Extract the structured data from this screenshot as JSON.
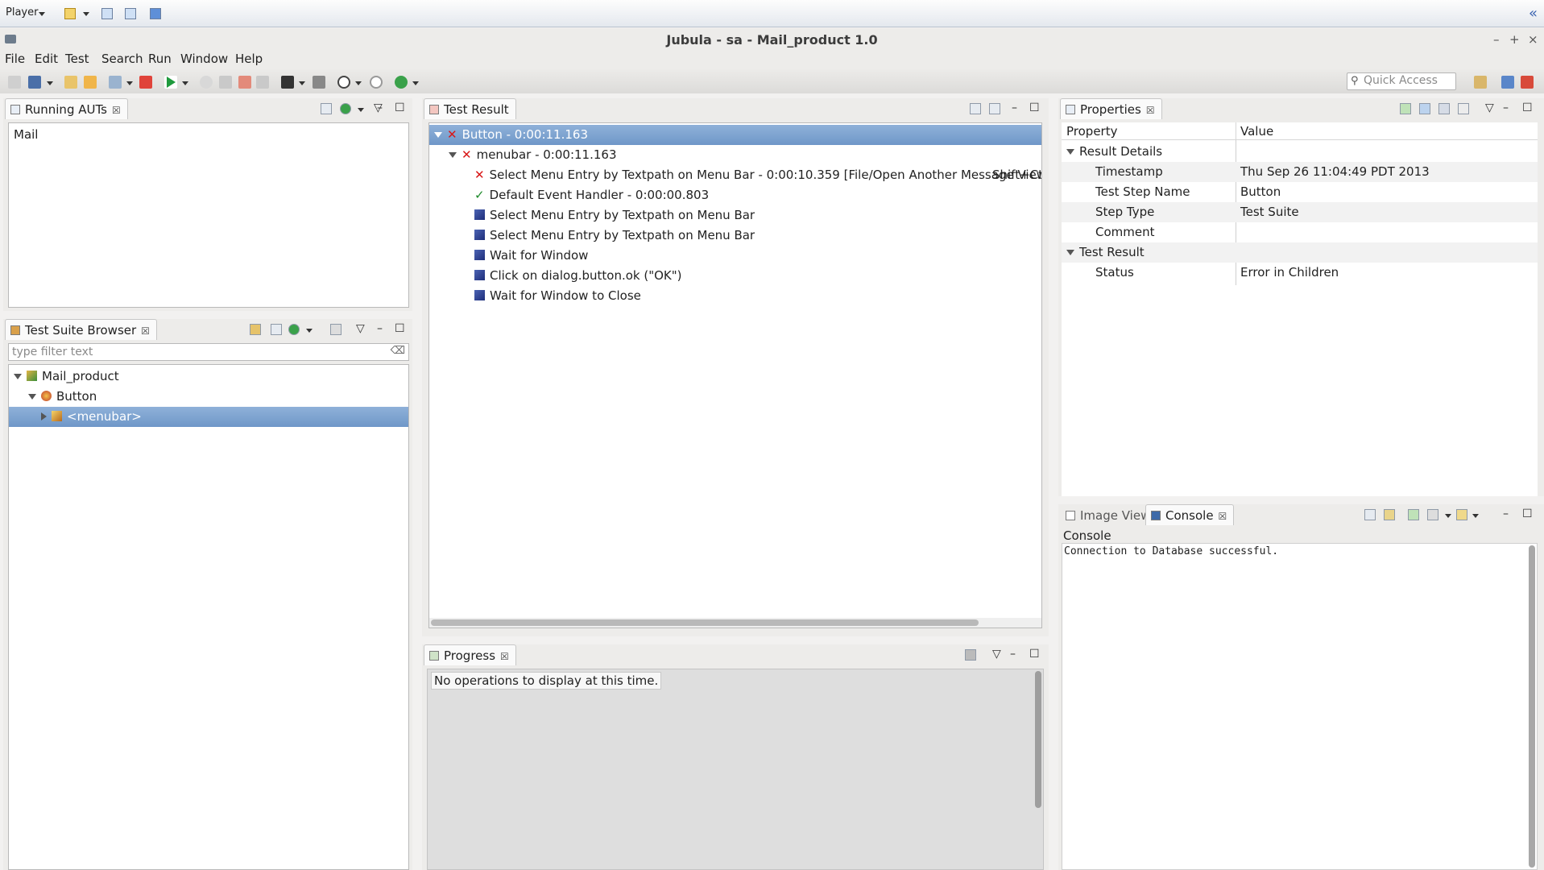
{
  "player_bar": {
    "label": "Player",
    "collapse_glyph": "«"
  },
  "window": {
    "title": "Jubula - sa - Mail_product 1.0",
    "controls": [
      "–",
      "+",
      "×"
    ]
  },
  "menu": {
    "items": [
      "File",
      "Edit",
      "Test",
      "Search",
      "Run",
      "Window",
      "Help"
    ]
  },
  "toolbar": {
    "quick_access_placeholder": "Quick Access"
  },
  "running_auts": {
    "tab_label": "Running AUTs",
    "items": [
      "Mail"
    ]
  },
  "test_suite_browser": {
    "tab_label": "Test Suite Browser",
    "filter_placeholder": "type filter text",
    "tree": {
      "root": "Mail_product",
      "child": "Button",
      "grandchild": "<menubar>"
    }
  },
  "test_result": {
    "tab_label": "Test Result",
    "root": "Button - 0:00:11.163",
    "menubar": "menubar - 0:00:11.163",
    "steps": [
      {
        "status": "fail",
        "text": "Select Menu Entry by Textpath on Menu Bar - 0:00:10.359 [File/Open Another Message View",
        "extra": "Shift+Ctr"
      },
      {
        "status": "pass",
        "text": "Default Event Handler - 0:00:00.803",
        "extra": ""
      },
      {
        "status": "pending",
        "text": "Select Menu Entry by Textpath on Menu Bar",
        "extra": ""
      },
      {
        "status": "pending",
        "text": "Select Menu Entry by Textpath on Menu Bar",
        "extra": ""
      },
      {
        "status": "pending",
        "text": "Wait for Window",
        "extra": ""
      },
      {
        "status": "pending",
        "text": "Click on dialog.button.ok (\"OK\")",
        "extra": ""
      },
      {
        "status": "pending",
        "text": "Wait for Window to Close",
        "extra": ""
      }
    ]
  },
  "progress": {
    "tab_label": "Progress",
    "message": "No operations to display at this time."
  },
  "properties": {
    "tab_label": "Properties",
    "col_property": "Property",
    "col_value": "Value",
    "group1": "Result Details",
    "group1_rows": [
      {
        "key": "Timestamp",
        "value": "Thu Sep 26 11:04:49 PDT 2013"
      },
      {
        "key": "Test Step Name",
        "value": "Button"
      },
      {
        "key": "Step Type",
        "value": "Test Suite"
      },
      {
        "key": "Comment",
        "value": ""
      }
    ],
    "group2": "Test Result",
    "group2_rows": [
      {
        "key": "Status",
        "value": "Error in Children"
      }
    ]
  },
  "console": {
    "tab_image_view": "Image View",
    "tab_console": "Console",
    "heading": "Console",
    "line": "Connection to Database successful."
  },
  "colors": {
    "selection": "#7aa0cd",
    "fail": "#d81818",
    "pass": "#1d8a2a"
  }
}
